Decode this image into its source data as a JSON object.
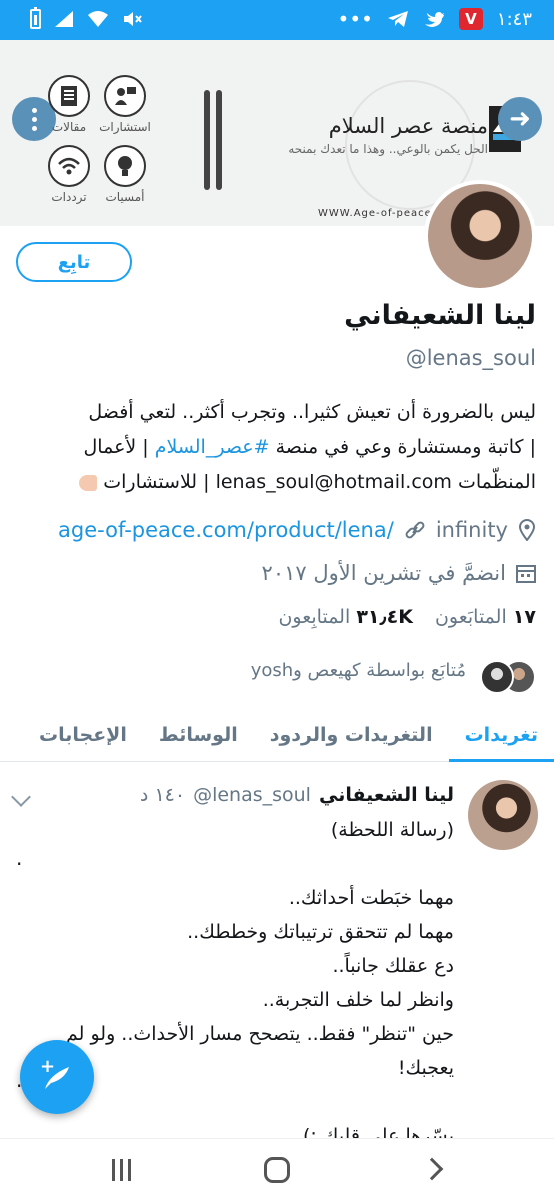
{
  "status_bar": {
    "time": "١:٤٣",
    "badge_letter": "V",
    "dots": "•••"
  },
  "banner": {
    "labels": {
      "consultations": "استشارات",
      "articles": "مقالات",
      "evenings": "أمسيات",
      "frequencies": "ترددات"
    },
    "brand_title": "منصة عصر السلام",
    "brand_tagline": "الحل يكمن بالوعي.. وهذا ما تعدك بمنحه",
    "url": "WWW.Age-of-peace.c"
  },
  "profile": {
    "follow_label": "تابِع",
    "name": "لينا الشعيفاني",
    "handle": "@lenas_soul",
    "bio_line1": "ليس بالضرورة أن تعيش كثيرا.. وتجرب أكثر.. لتعي أفضل",
    "bio_line2_prefix": "| كاتبة ومستشارة وعي في منصة ",
    "bio_hashtag": "#عصر_السلام",
    "bio_line2_suffix": " | لأعمال",
    "bio_line3": "المنظّمات lenas_soul@hotmail.com | للاستشارات",
    "location": "infinity",
    "website": "age-of-peace.com/product/lena/",
    "joined": "انضمَّ في تشرين الأول ٢٠١٧",
    "following_count": "١٧",
    "following_label": "المتابَعون",
    "followers_count": "٣١٫٤K",
    "followers_label": "المتابِعون",
    "followed_by": "مُتابَع بواسطة كهيعص وyosh"
  },
  "tabs": [
    {
      "label": "تغريدات",
      "active": true
    },
    {
      "label": "التغريدات والردود",
      "active": false
    },
    {
      "label": "الوسائط",
      "active": false
    },
    {
      "label": "الإعجابات",
      "active": false
    }
  ],
  "tweet": {
    "name": "لينا الشعيفاني",
    "handle": "@lenas_soul",
    "time": "١٤٠ د",
    "lines": [
      "(رسالة اللحظة)",
      "",
      "مهما خبَطت أحداثك..",
      "مهما لم تتحقق ترتيباتك وخططك..",
      "دع عقلك جانباً..",
      "وانظر لما خلف التجربة..",
      "حين \"تنظر\" فقط.. يتصحح مسار الأحداث.. ولو لم",
      "يعجبك!",
      "",
      "يسّرها على قلبك :)"
    ],
    "side_dot": "."
  },
  "fab": {
    "label": "+"
  },
  "colors": {
    "accent": "#1da1f2",
    "link": "#1b95e0",
    "muted": "#657786"
  }
}
